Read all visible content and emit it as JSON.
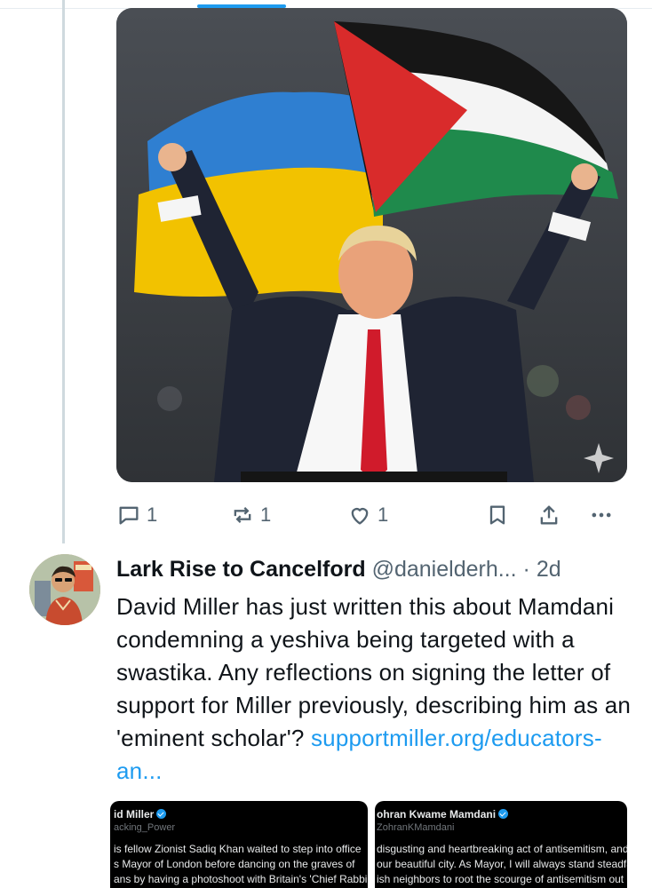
{
  "media": {
    "flag_colors": {
      "blue": "#2f7fd1",
      "yellow": "#f2c200",
      "red": "#d92b2b",
      "green": "#1f8a4c",
      "black": "#161616",
      "white": "#f4f4f4"
    },
    "tie_color": "#d01b2b"
  },
  "first_tweet_actions": {
    "reply_count": "1",
    "retweet_count": "1",
    "like_count": "1"
  },
  "tweet": {
    "display_name": "Lark Rise to Cancelford",
    "handle": "@danielderh...",
    "separator": "·",
    "time": "2d",
    "text": "David Miller has just written this about Mamdani condemning a yeshiva being targeted with a swastika. Any reflections on signing the letter of support for Miller previously, describing him as an 'eminent scholar'? ",
    "link": "supportmiller.org/educators-an..."
  },
  "quote_cards": [
    {
      "name": "id Miller",
      "handle": "acking_Power",
      "lines": [
        "is fellow Zionist Sadiq Khan waited to step into office",
        "s Mayor of London before dancing on the graves of",
        "ans by having a photoshoot with Britain's 'Chief Rabbi'"
      ]
    },
    {
      "name": "ohran Kwame Mamdani",
      "handle": "ZohranKMamdani",
      "lines": [
        "disgusting and heartbreaking act of antisemitism, and it h",
        "our beautiful city. As Mayor, I will always stand steadfast w",
        "ish neighbors to root the scourge of antisemitism out of ou"
      ]
    }
  ],
  "colors": {
    "accent": "#1d9bf0",
    "muted": "#536471",
    "text": "#0f1419",
    "thread_line": "#cfd9de"
  }
}
